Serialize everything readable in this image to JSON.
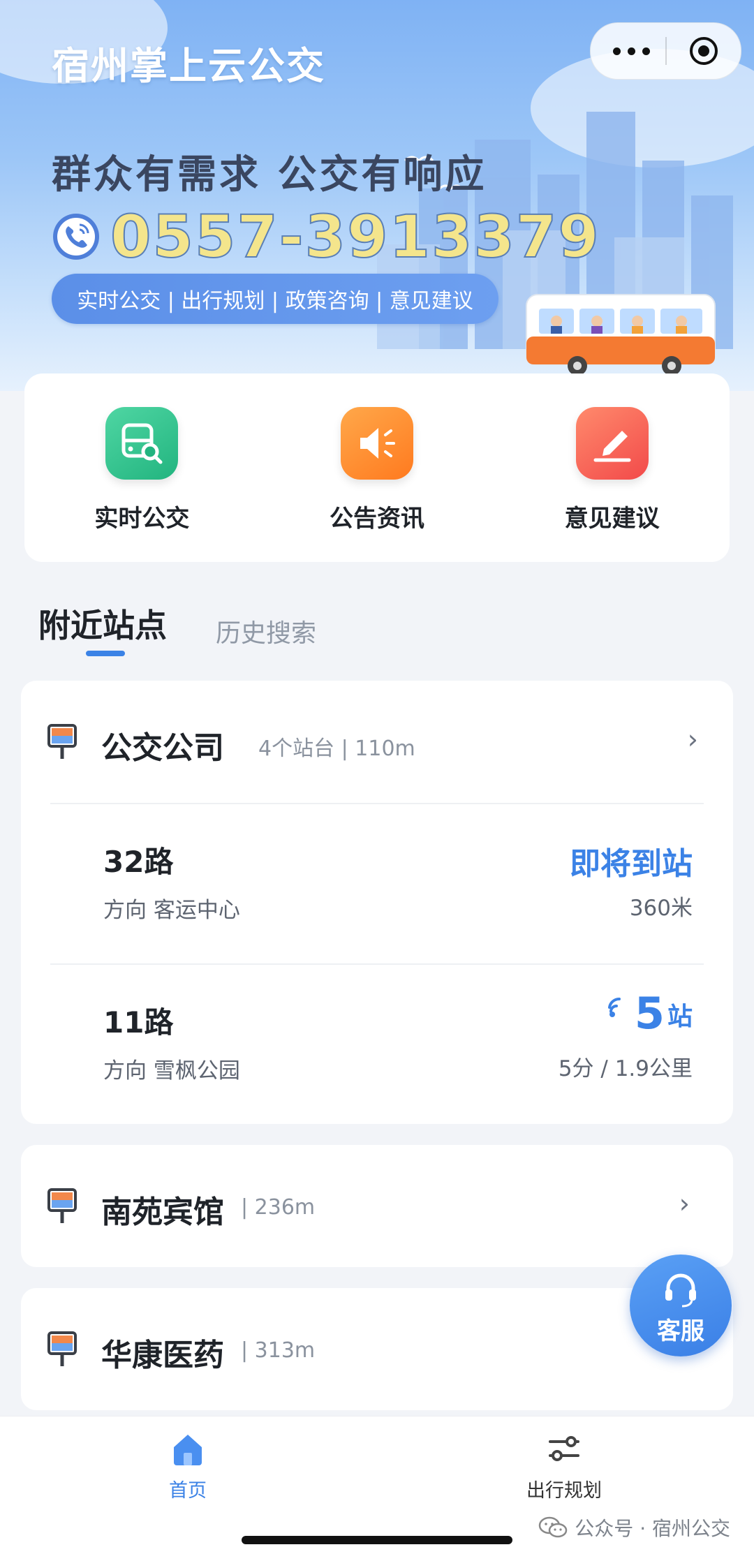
{
  "app": {
    "title": "宿州掌上云公交"
  },
  "banner": {
    "slogan": "群众有需求  公交有响应",
    "phone": "0557-3913379",
    "tags": "实时公交 | 出行规划 | 政策咨询 | 意见建议"
  },
  "quick_actions": [
    {
      "label": "实时公交",
      "icon": "bus-search-icon"
    },
    {
      "label": "公告资讯",
      "icon": "speaker-icon"
    },
    {
      "label": "意见建议",
      "icon": "edit-pencil-icon"
    }
  ],
  "tabs": {
    "active": "附近站点",
    "inactive": "历史搜索"
  },
  "stations": [
    {
      "name": "公交公司",
      "meta": "4个站台 | 110m",
      "routes": [
        {
          "name": "32路",
          "direction": "方向 客运中心",
          "status": "即将到站",
          "distance": "360米"
        },
        {
          "name": "11路",
          "direction": "方向 雪枫公园",
          "stops": "5",
          "stops_unit": "站",
          "eta": "5分 / 1.9公里"
        }
      ]
    },
    {
      "name": "南苑宾馆",
      "meta": "| 236m"
    },
    {
      "name": "华康医药",
      "meta": "| 313m"
    }
  ],
  "customer_service": {
    "label": "客服"
  },
  "bottom_nav": [
    {
      "label": "首页",
      "icon": "home-icon",
      "active": true
    },
    {
      "label": "出行规划",
      "icon": "route-plan-icon",
      "active": false
    }
  ],
  "watermark": "公众号 · 宿州公交",
  "colors": {
    "accent": "#3b82e6",
    "phone_text": "#f4e58c"
  }
}
